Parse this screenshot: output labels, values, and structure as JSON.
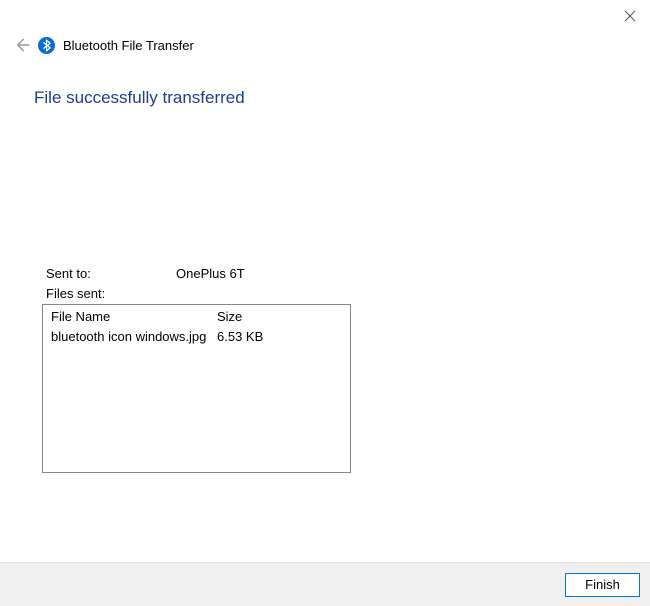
{
  "window": {
    "title": "Bluetooth File Transfer"
  },
  "status": {
    "heading": "File successfully transferred"
  },
  "info": {
    "sent_to_label": "Sent to:",
    "sent_to_value": "OnePlus 6T",
    "files_sent_label": "Files sent:"
  },
  "file_list": {
    "headers": {
      "name": "File Name",
      "size": "Size"
    },
    "rows": [
      {
        "name": "bluetooth icon windows.jpg",
        "size": "6.53 KB"
      }
    ]
  },
  "buttons": {
    "finish": "Finish"
  }
}
